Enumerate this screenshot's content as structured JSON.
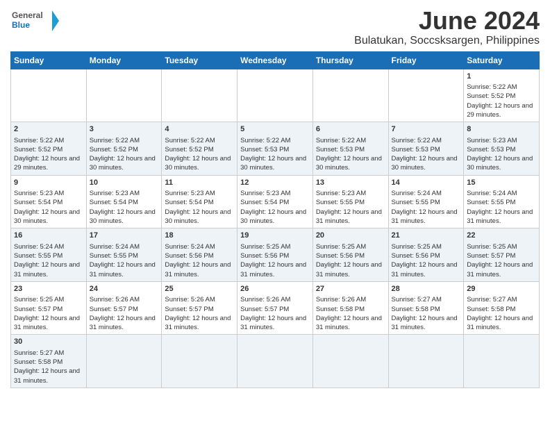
{
  "logo": {
    "line1": "General",
    "line2": "Blue"
  },
  "title": "June 2024",
  "subtitle": "Bulatukan, Soccsksargen, Philippines",
  "days": [
    "Sunday",
    "Monday",
    "Tuesday",
    "Wednesday",
    "Thursday",
    "Friday",
    "Saturday"
  ],
  "weeks": [
    [
      {
        "date": "",
        "info": ""
      },
      {
        "date": "",
        "info": ""
      },
      {
        "date": "",
        "info": ""
      },
      {
        "date": "",
        "info": ""
      },
      {
        "date": "",
        "info": ""
      },
      {
        "date": "",
        "info": ""
      },
      {
        "date": "1",
        "info": "Sunrise: 5:22 AM\nSunset: 5:52 PM\nDaylight: 12 hours and 29 minutes."
      }
    ],
    [
      {
        "date": "2",
        "info": "Sunrise: 5:22 AM\nSunset: 5:52 PM\nDaylight: 12 hours and 29 minutes."
      },
      {
        "date": "3",
        "info": "Sunrise: 5:22 AM\nSunset: 5:52 PM\nDaylight: 12 hours and 30 minutes."
      },
      {
        "date": "4",
        "info": "Sunrise: 5:22 AM\nSunset: 5:52 PM\nDaylight: 12 hours and 30 minutes."
      },
      {
        "date": "5",
        "info": "Sunrise: 5:22 AM\nSunset: 5:53 PM\nDaylight: 12 hours and 30 minutes."
      },
      {
        "date": "6",
        "info": "Sunrise: 5:22 AM\nSunset: 5:53 PM\nDaylight: 12 hours and 30 minutes."
      },
      {
        "date": "7",
        "info": "Sunrise: 5:22 AM\nSunset: 5:53 PM\nDaylight: 12 hours and 30 minutes."
      },
      {
        "date": "8",
        "info": "Sunrise: 5:23 AM\nSunset: 5:53 PM\nDaylight: 12 hours and 30 minutes."
      }
    ],
    [
      {
        "date": "9",
        "info": "Sunrise: 5:23 AM\nSunset: 5:54 PM\nDaylight: 12 hours and 30 minutes."
      },
      {
        "date": "10",
        "info": "Sunrise: 5:23 AM\nSunset: 5:54 PM\nDaylight: 12 hours and 30 minutes."
      },
      {
        "date": "11",
        "info": "Sunrise: 5:23 AM\nSunset: 5:54 PM\nDaylight: 12 hours and 30 minutes."
      },
      {
        "date": "12",
        "info": "Sunrise: 5:23 AM\nSunset: 5:54 PM\nDaylight: 12 hours and 30 minutes."
      },
      {
        "date": "13",
        "info": "Sunrise: 5:23 AM\nSunset: 5:55 PM\nDaylight: 12 hours and 31 minutes."
      },
      {
        "date": "14",
        "info": "Sunrise: 5:24 AM\nSunset: 5:55 PM\nDaylight: 12 hours and 31 minutes."
      },
      {
        "date": "15",
        "info": "Sunrise: 5:24 AM\nSunset: 5:55 PM\nDaylight: 12 hours and 31 minutes."
      }
    ],
    [
      {
        "date": "16",
        "info": "Sunrise: 5:24 AM\nSunset: 5:55 PM\nDaylight: 12 hours and 31 minutes."
      },
      {
        "date": "17",
        "info": "Sunrise: 5:24 AM\nSunset: 5:55 PM\nDaylight: 12 hours and 31 minutes."
      },
      {
        "date": "18",
        "info": "Sunrise: 5:24 AM\nSunset: 5:56 PM\nDaylight: 12 hours and 31 minutes."
      },
      {
        "date": "19",
        "info": "Sunrise: 5:25 AM\nSunset: 5:56 PM\nDaylight: 12 hours and 31 minutes."
      },
      {
        "date": "20",
        "info": "Sunrise: 5:25 AM\nSunset: 5:56 PM\nDaylight: 12 hours and 31 minutes."
      },
      {
        "date": "21",
        "info": "Sunrise: 5:25 AM\nSunset: 5:56 PM\nDaylight: 12 hours and 31 minutes."
      },
      {
        "date": "22",
        "info": "Sunrise: 5:25 AM\nSunset: 5:57 PM\nDaylight: 12 hours and 31 minutes."
      }
    ],
    [
      {
        "date": "23",
        "info": "Sunrise: 5:25 AM\nSunset: 5:57 PM\nDaylight: 12 hours and 31 minutes."
      },
      {
        "date": "24",
        "info": "Sunrise: 5:26 AM\nSunset: 5:57 PM\nDaylight: 12 hours and 31 minutes."
      },
      {
        "date": "25",
        "info": "Sunrise: 5:26 AM\nSunset: 5:57 PM\nDaylight: 12 hours and 31 minutes."
      },
      {
        "date": "26",
        "info": "Sunrise: 5:26 AM\nSunset: 5:57 PM\nDaylight: 12 hours and 31 minutes."
      },
      {
        "date": "27",
        "info": "Sunrise: 5:26 AM\nSunset: 5:58 PM\nDaylight: 12 hours and 31 minutes."
      },
      {
        "date": "28",
        "info": "Sunrise: 5:27 AM\nSunset: 5:58 PM\nDaylight: 12 hours and 31 minutes."
      },
      {
        "date": "29",
        "info": "Sunrise: 5:27 AM\nSunset: 5:58 PM\nDaylight: 12 hours and 31 minutes."
      }
    ],
    [
      {
        "date": "30",
        "info": "Sunrise: 5:27 AM\nSunset: 5:58 PM\nDaylight: 12 hours and 31 minutes."
      },
      {
        "date": "",
        "info": ""
      },
      {
        "date": "",
        "info": ""
      },
      {
        "date": "",
        "info": ""
      },
      {
        "date": "",
        "info": ""
      },
      {
        "date": "",
        "info": ""
      },
      {
        "date": "",
        "info": ""
      }
    ]
  ]
}
